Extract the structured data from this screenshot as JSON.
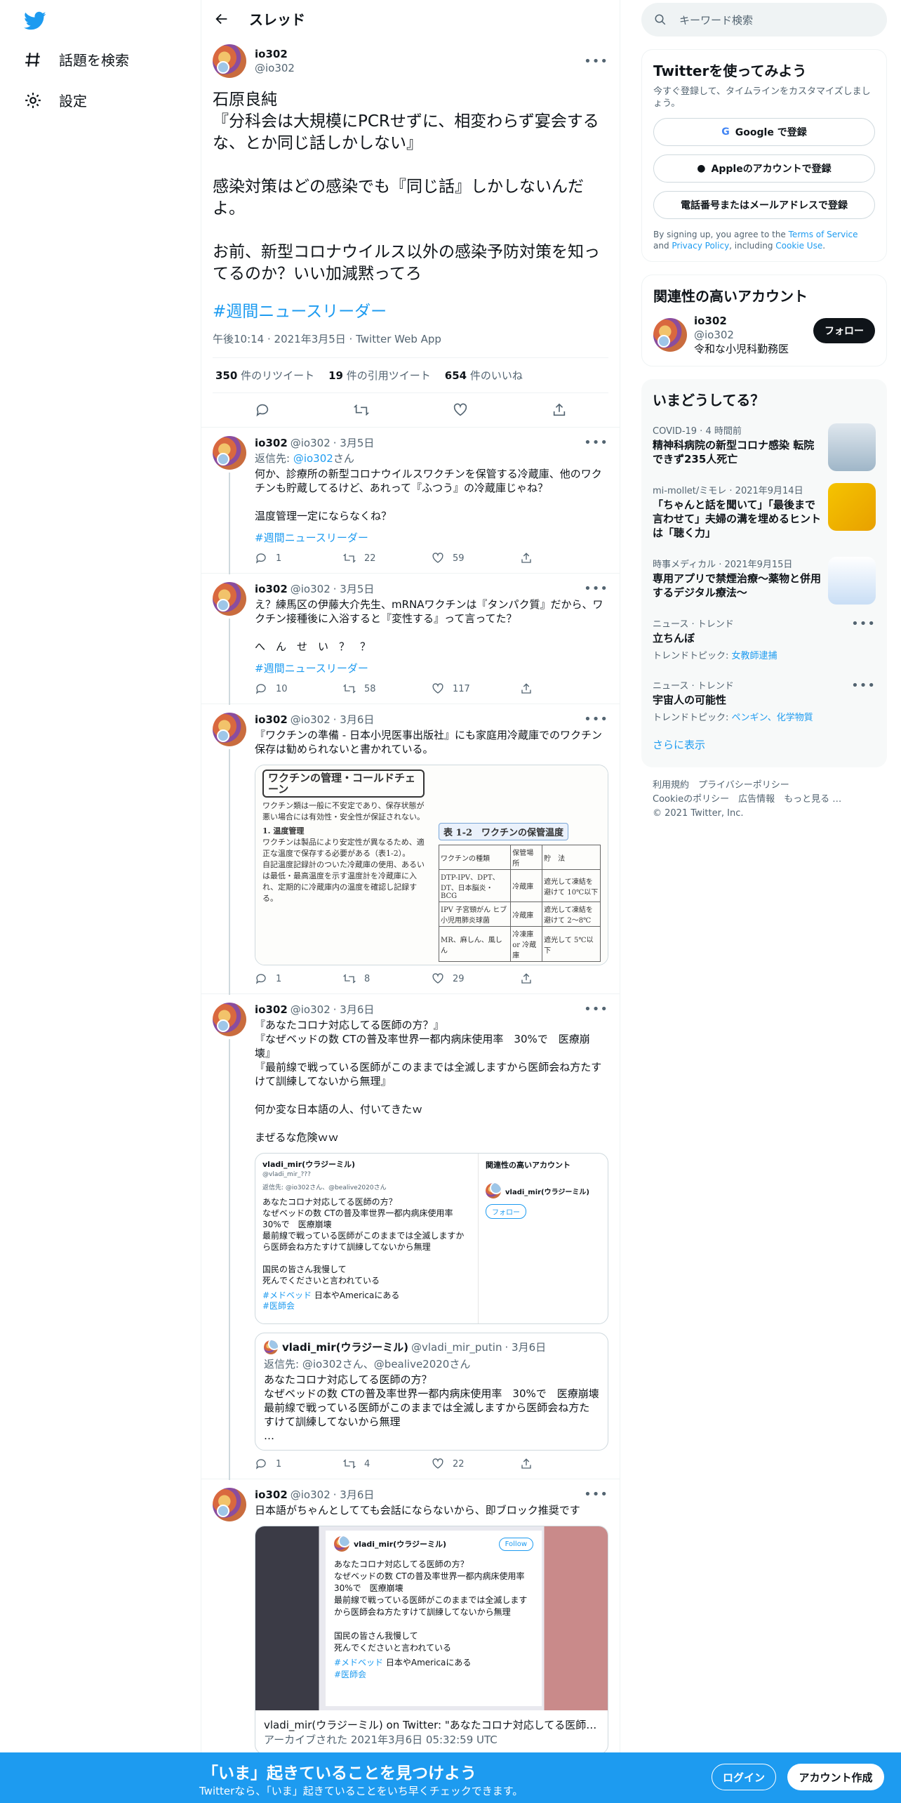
{
  "nav": {
    "explore": "話題を検索",
    "settings": "設定"
  },
  "header": {
    "title": "スレッド"
  },
  "main_tweet": {
    "name": "io302",
    "handle": "@io302",
    "text": "石原良純\n『分科会は大規模にPCRせずに、相変わらず宴会するな、とか同じ話しかしない』\n\n感染対策はどの感染でも『同じ話』しかしないんだよ。\n\nお前、新型コロナウイルス以外の感染予防対策を知ってるのか？いい加減黙ってろ",
    "hashtag": "#週間ニュースリーダー",
    "meta": "午後10:14 · 2021年3月5日 · Twitter Web App",
    "retweets_n": "350",
    "retweets_l": "件のリツイート",
    "quotes_n": "19",
    "quotes_l": "件の引用ツイート",
    "likes_n": "654",
    "likes_l": "件のいいね"
  },
  "replies": [
    {
      "name": "io302",
      "handle": "@io302",
      "date": "· 3月5日",
      "reply_to_prefix": "返信先: ",
      "reply_to": "@io302",
      "reply_to_suffix": "さん",
      "text": "何か、診療所の新型コロナウイルスワクチンを保管する冷蔵庫、他のワクチンも貯蔵してるけど、あれって『ふつう』の冷蔵庫じゃね？\n\n温度管理一定にならなくね？",
      "hashtag": "#週間ニュースリーダー",
      "replies": "1",
      "retweets": "22",
      "likes": "59"
    },
    {
      "name": "io302",
      "handle": "@io302",
      "date": "· 3月5日",
      "text": "え？練馬区の伊藤大介先生、mRNAワクチンは『タンパク質』だから、ワクチン接種後に入浴すると『変性する』って言ってた？\n\nへ　ん　せ　い　？　？",
      "hashtag": "#週間ニュースリーダー",
      "replies": "10",
      "retweets": "58",
      "likes": "117"
    },
    {
      "name": "io302",
      "handle": "@io302",
      "date": "· 3月6日",
      "text": "『ワクチンの準備 - 日本小児医事出版社』にも家庭用冷蔵庫でのワクチン保存は勧められないと書かれている。",
      "image": {
        "title": "ワクチンの管理・コールドチェーン",
        "p1": "ワクチン類は一般に不安定であり、保存状態が悪い場合には有効性・安全性が保証されない。",
        "h1": "1. 温度管理",
        "p2": "ワクチンは製品により安定性が異なるため、適正な温度で保存する必要がある（表1-2）。\n自記温度記録計のついた冷蔵庫の使用、あるいは最低・最高温度を示す温度計を冷蔵庫に入れ、定期的に冷蔵庫内の温度を確認し記録する。",
        "badge": "表 1-2　ワクチンの保管温度",
        "col1": "ワクチンの種類",
        "col2": "保管場所",
        "col3": "貯　法",
        "r1a": "DTP-IPV、DPT、DT、日本脳炎・BCG",
        "r1b": "冷蔵庫",
        "r1c": "遮光して凍結を避けて 10℃以下",
        "r2a": "IPV 子宮頸がん ヒブ 小児用肺炎球菌",
        "r2b": "冷蔵庫",
        "r2c": "遮光して凍結を避けて 2～8℃",
        "r3a": "MR、麻しん、風しん",
        "r3b": "冷凍庫 or 冷蔵庫",
        "r3c": "遮光して 5℃以下"
      },
      "replies": "1",
      "retweets": "8",
      "likes": "29"
    },
    {
      "name": "io302",
      "handle": "@io302",
      "date": "· 3月6日",
      "text": "『あなたコロナ対応してる医師の方？』\n『なぜベッドの数 CTの普及率世界一都内病床使用率　30%で　医療崩壊』\n『最前線で戦っている医師がこのままでは全滅しますから医師会ね方たすけて訓練してないから無理』\n\n何か変な日本語の人、付いてきたｗ\n\nまぜるな危険ｗｗ",
      "shot": {
        "name": "vladi_mir(ウラジーミル)",
        "handle": "@vladi_mir_???",
        "reply": "返信先: @io302さん、@bealive2020さん",
        "text": "あなたコロナ対応してる医師の方？\nなぜベッドの数 CTの普及率世界一都内病床使用率\n30%で　医療崩壊\n最前線で戦っている医師がこのままでは全滅しますから医師会ね方たすけて訓練してないから無理\n\n国民の皆さん我慢して\n死んでくださいと言われている",
        "tag1": "#メドベッド",
        "tag1_rest": " 日本やAmericaにある",
        "tag2": "#医師会",
        "side_title": "関連性の高いアカウント",
        "side_follow": "フォロー"
      },
      "quote": {
        "name": "vladi_mir(ウラジーミル)",
        "handle": "@vladi_mir_putin",
        "date": "· 3月6日",
        "reply": "返信先: @io302さん、@bealive2020さん",
        "text": "あなたコロナ対応してる医師の方？\nなぜベッドの数 CTの普及率世界一都内病床使用率　30%で　医療崩壊\n最前線で戦っている医師がこのままでは全滅しますから医師会ね方たすけて訓練してないから無理\n…"
      },
      "replies": "1",
      "retweets": "4",
      "likes": "22"
    },
    {
      "name": "io302",
      "handle": "@io302",
      "date": "· 3月6日",
      "text": "日本語がちゃんとしてても会話にならないから、即ブロック推奨です",
      "shot": {
        "name": "vladi_mir(ウラジーミル)",
        "follow": "Follow",
        "text": "あなたコロナ対応してる医師の方？\nなぜベッドの数 CTの普及率世界一都内病床使用率　30%で　医療崩壊\n最前線で戦っている医師がこのままでは全滅しますから医師会ね方たすけて訓練してないから無理\n\n国民の皆さん我慢して\n死んでくださいと言われている",
        "tag1": "#メドベッド",
        "tag1_rest": " 日本やAmericaにある",
        "tag2": "#医師会"
      },
      "link_title": "vladi_mir(ウラジーミル) on Twitter: \"あなたコロナ対応してる医師の方…",
      "link_sub": "アーカイブされた 2021年3月6日 05:32:59 UTC"
    }
  ],
  "right": {
    "search_placeholder": "キーワード検索",
    "signup_title": "Twitterを使ってみよう",
    "signup_desc": "今すぐ登録して、タイムラインをカスタマイズしましょう。",
    "google": "Google で登録",
    "apple": "Appleのアカウントで登録",
    "phone": "電話番号またはメールアドレスで登録",
    "terms_pre": "By signing up, you agree to the ",
    "terms_tos": "Terms of Service",
    "terms_and": " and ",
    "terms_privacy": "Privacy Policy",
    "terms_incl": ", including ",
    "terms_cookie": "Cookie Use",
    "terms_end": ".",
    "related_title": "関連性の高いアカウント",
    "rel_name": "io302",
    "rel_handle": "@io302",
    "rel_bio": "令和な小児科勤務医",
    "follow": "フォロー",
    "trends_title": "いまどうしてる？",
    "trends": [
      {
        "meta": "COVID-19 · 4 時間前",
        "title": "精神科病院の新型コロナ感染 転院できず235人死亡"
      },
      {
        "meta": "mi-mollet/ミモレ · 2021年9月14日",
        "title": "「ちゃんと話を聞いて」「最後まで言わせて」夫婦の溝を埋めるヒントは「聴く力」"
      },
      {
        "meta": "時事メディカル · 2021年9月15日",
        "title": "専用アプリで禁煙治療～薬物と併用するデジタル療法～"
      },
      {
        "meta": "ニュース · トレンド",
        "title": "立ちんぼ",
        "sub_pre": "トレンドトピック: ",
        "sub_link": "女教師逮捕"
      },
      {
        "meta": "ニュース · トレンド",
        "title": "宇宙人の可能性",
        "sub_pre": "トレンドトピック: ",
        "sub_link": "ペンギン、化学物質"
      }
    ],
    "show_more": "さらに表示",
    "footer1": "利用規約　プライバシーポリシー",
    "footer2": "Cookieのポリシー　広告情報　もっと見る …",
    "footer3": "© 2021 Twitter, Inc."
  },
  "banner": {
    "headline": "「いま」起きていることを見つけよう",
    "sub": "Twitterなら、「いま」起きていることをいち早くチェックできます。",
    "login": "ログイン",
    "signup": "アカウント作成"
  },
  "colors": {
    "accent": "#1d9bf0",
    "text": "#0f1419",
    "muted": "#536471"
  }
}
